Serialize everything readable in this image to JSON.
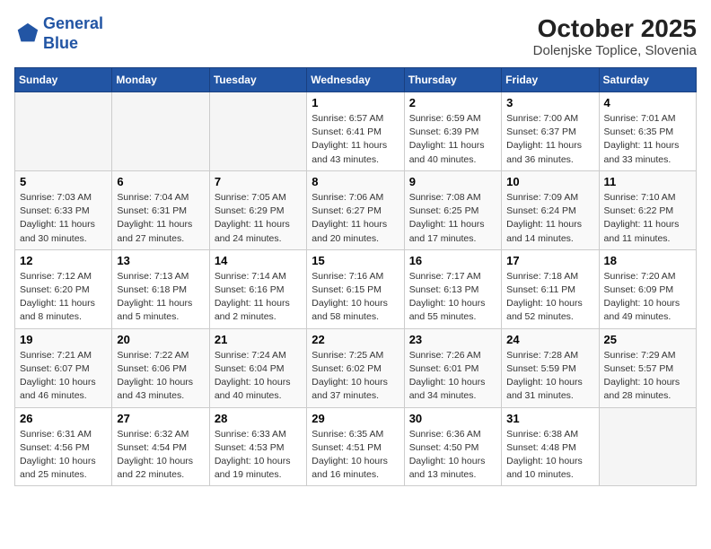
{
  "header": {
    "logo_line1": "General",
    "logo_line2": "Blue",
    "month": "October 2025",
    "location": "Dolenjske Toplice, Slovenia"
  },
  "weekdays": [
    "Sunday",
    "Monday",
    "Tuesday",
    "Wednesday",
    "Thursday",
    "Friday",
    "Saturday"
  ],
  "weeks": [
    [
      {
        "day": "",
        "info": ""
      },
      {
        "day": "",
        "info": ""
      },
      {
        "day": "",
        "info": ""
      },
      {
        "day": "1",
        "info": "Sunrise: 6:57 AM\nSunset: 6:41 PM\nDaylight: 11 hours and 43 minutes."
      },
      {
        "day": "2",
        "info": "Sunrise: 6:59 AM\nSunset: 6:39 PM\nDaylight: 11 hours and 40 minutes."
      },
      {
        "day": "3",
        "info": "Sunrise: 7:00 AM\nSunset: 6:37 PM\nDaylight: 11 hours and 36 minutes."
      },
      {
        "day": "4",
        "info": "Sunrise: 7:01 AM\nSunset: 6:35 PM\nDaylight: 11 hours and 33 minutes."
      }
    ],
    [
      {
        "day": "5",
        "info": "Sunrise: 7:03 AM\nSunset: 6:33 PM\nDaylight: 11 hours and 30 minutes."
      },
      {
        "day": "6",
        "info": "Sunrise: 7:04 AM\nSunset: 6:31 PM\nDaylight: 11 hours and 27 minutes."
      },
      {
        "day": "7",
        "info": "Sunrise: 7:05 AM\nSunset: 6:29 PM\nDaylight: 11 hours and 24 minutes."
      },
      {
        "day": "8",
        "info": "Sunrise: 7:06 AM\nSunset: 6:27 PM\nDaylight: 11 hours and 20 minutes."
      },
      {
        "day": "9",
        "info": "Sunrise: 7:08 AM\nSunset: 6:25 PM\nDaylight: 11 hours and 17 minutes."
      },
      {
        "day": "10",
        "info": "Sunrise: 7:09 AM\nSunset: 6:24 PM\nDaylight: 11 hours and 14 minutes."
      },
      {
        "day": "11",
        "info": "Sunrise: 7:10 AM\nSunset: 6:22 PM\nDaylight: 11 hours and 11 minutes."
      }
    ],
    [
      {
        "day": "12",
        "info": "Sunrise: 7:12 AM\nSunset: 6:20 PM\nDaylight: 11 hours and 8 minutes."
      },
      {
        "day": "13",
        "info": "Sunrise: 7:13 AM\nSunset: 6:18 PM\nDaylight: 11 hours and 5 minutes."
      },
      {
        "day": "14",
        "info": "Sunrise: 7:14 AM\nSunset: 6:16 PM\nDaylight: 11 hours and 2 minutes."
      },
      {
        "day": "15",
        "info": "Sunrise: 7:16 AM\nSunset: 6:15 PM\nDaylight: 10 hours and 58 minutes."
      },
      {
        "day": "16",
        "info": "Sunrise: 7:17 AM\nSunset: 6:13 PM\nDaylight: 10 hours and 55 minutes."
      },
      {
        "day": "17",
        "info": "Sunrise: 7:18 AM\nSunset: 6:11 PM\nDaylight: 10 hours and 52 minutes."
      },
      {
        "day": "18",
        "info": "Sunrise: 7:20 AM\nSunset: 6:09 PM\nDaylight: 10 hours and 49 minutes."
      }
    ],
    [
      {
        "day": "19",
        "info": "Sunrise: 7:21 AM\nSunset: 6:07 PM\nDaylight: 10 hours and 46 minutes."
      },
      {
        "day": "20",
        "info": "Sunrise: 7:22 AM\nSunset: 6:06 PM\nDaylight: 10 hours and 43 minutes."
      },
      {
        "day": "21",
        "info": "Sunrise: 7:24 AM\nSunset: 6:04 PM\nDaylight: 10 hours and 40 minutes."
      },
      {
        "day": "22",
        "info": "Sunrise: 7:25 AM\nSunset: 6:02 PM\nDaylight: 10 hours and 37 minutes."
      },
      {
        "day": "23",
        "info": "Sunrise: 7:26 AM\nSunset: 6:01 PM\nDaylight: 10 hours and 34 minutes."
      },
      {
        "day": "24",
        "info": "Sunrise: 7:28 AM\nSunset: 5:59 PM\nDaylight: 10 hours and 31 minutes."
      },
      {
        "day": "25",
        "info": "Sunrise: 7:29 AM\nSunset: 5:57 PM\nDaylight: 10 hours and 28 minutes."
      }
    ],
    [
      {
        "day": "26",
        "info": "Sunrise: 6:31 AM\nSunset: 4:56 PM\nDaylight: 10 hours and 25 minutes."
      },
      {
        "day": "27",
        "info": "Sunrise: 6:32 AM\nSunset: 4:54 PM\nDaylight: 10 hours and 22 minutes."
      },
      {
        "day": "28",
        "info": "Sunrise: 6:33 AM\nSunset: 4:53 PM\nDaylight: 10 hours and 19 minutes."
      },
      {
        "day": "29",
        "info": "Sunrise: 6:35 AM\nSunset: 4:51 PM\nDaylight: 10 hours and 16 minutes."
      },
      {
        "day": "30",
        "info": "Sunrise: 6:36 AM\nSunset: 4:50 PM\nDaylight: 10 hours and 13 minutes."
      },
      {
        "day": "31",
        "info": "Sunrise: 6:38 AM\nSunset: 4:48 PM\nDaylight: 10 hours and 10 minutes."
      },
      {
        "day": "",
        "info": ""
      }
    ]
  ]
}
